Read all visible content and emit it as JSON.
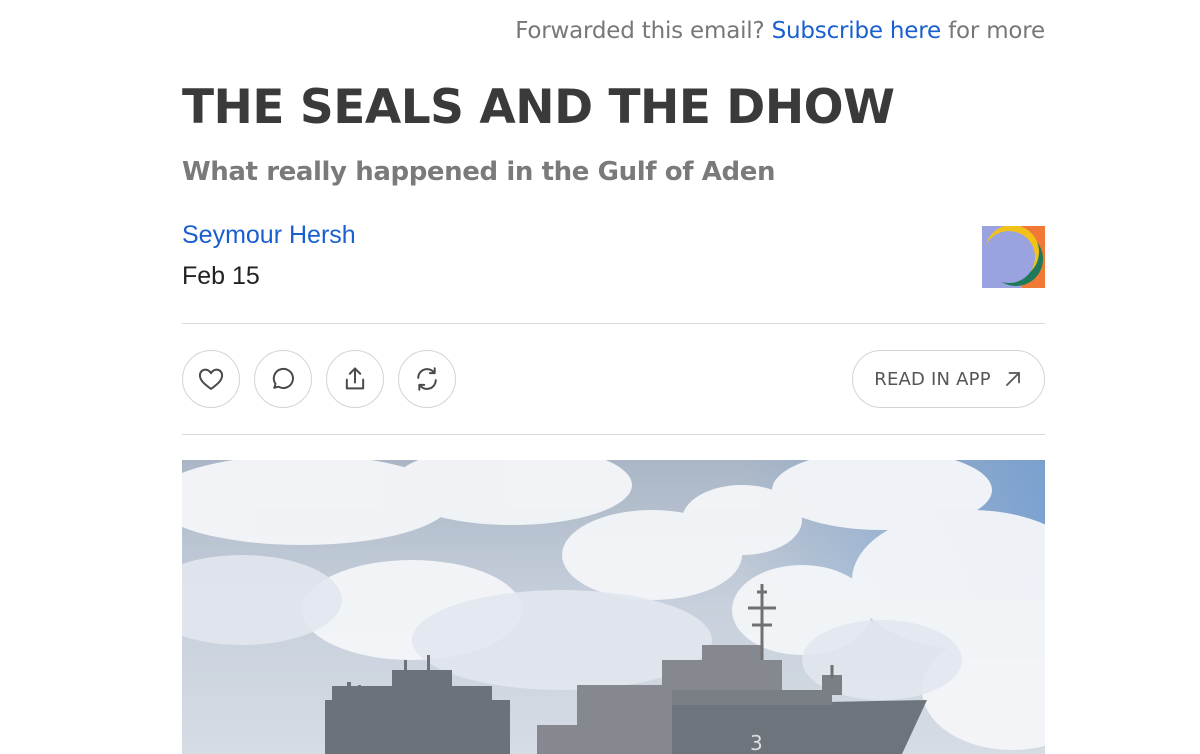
{
  "header": {
    "prefix": "Forwarded this email?",
    "link": "Subscribe here",
    "suffix": "for more"
  },
  "post": {
    "title": "THE SEALS AND THE DHOW",
    "subtitle": "What really happened in the Gulf of Aden",
    "author": "Seymour Hersh",
    "date": "Feb 15"
  },
  "actions": {
    "like_icon": "heart-icon",
    "comment_icon": "comment-icon",
    "share_icon": "share-icon",
    "restack_icon": "restack-icon",
    "read_in_app": "READ IN APP",
    "read_in_app_icon": "arrow-up-right-icon"
  },
  "hero_number": "3",
  "colors": {
    "link": "#1a5fd0",
    "title": "#3a3a3a",
    "muted": "#777777",
    "border": "#d4d4d4"
  }
}
